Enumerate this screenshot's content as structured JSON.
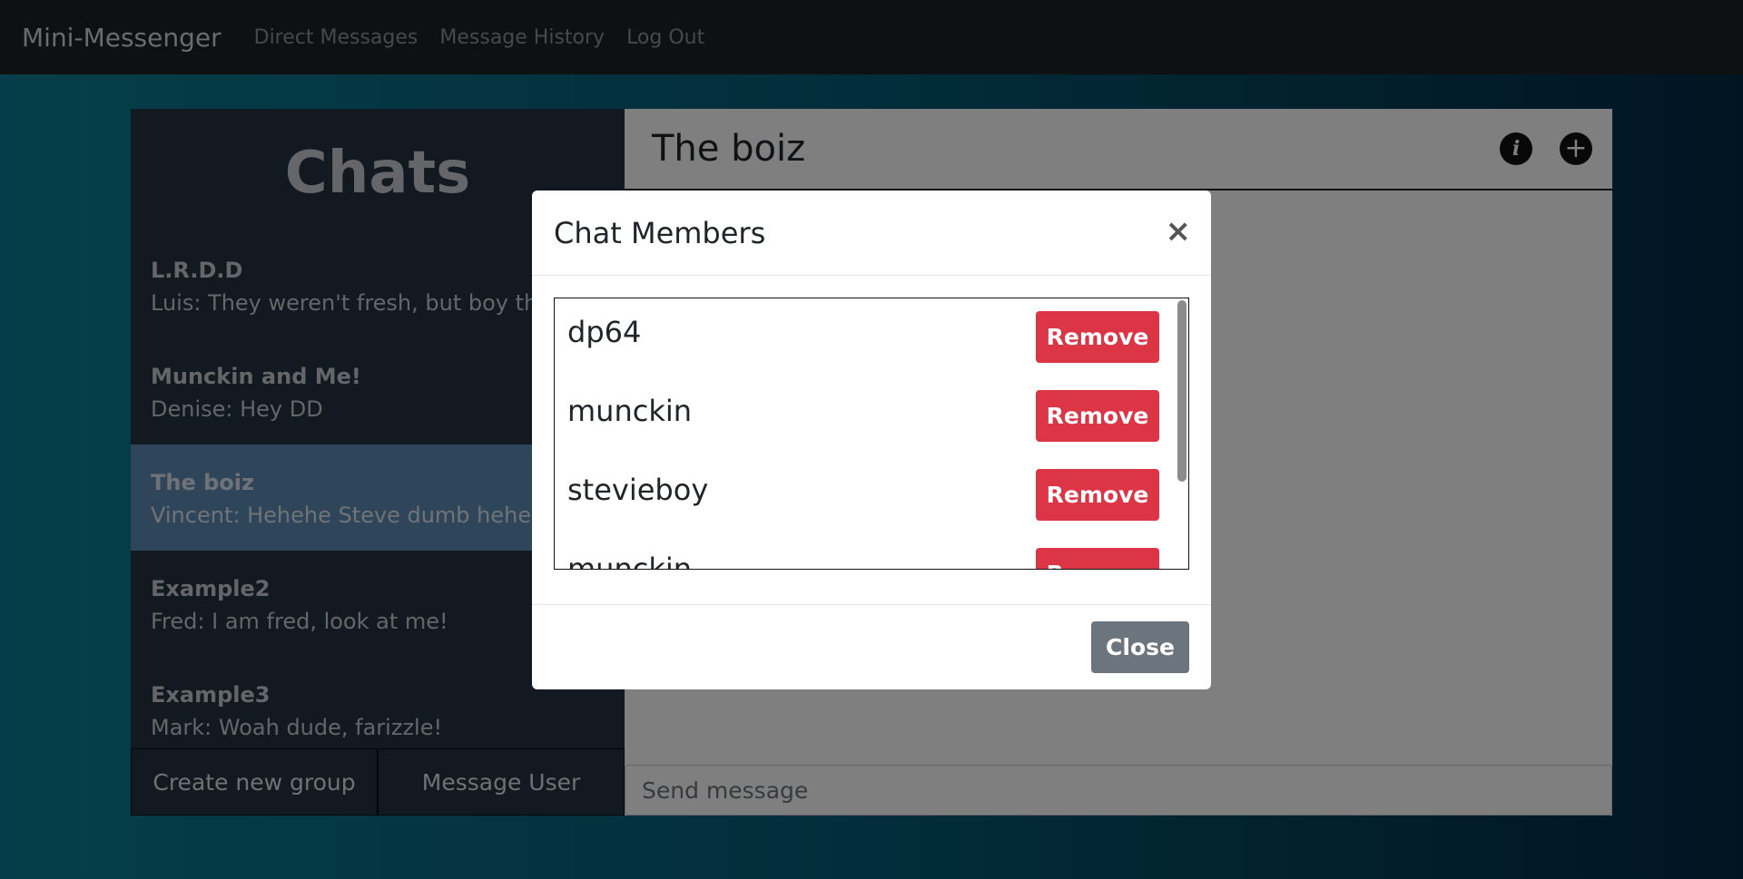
{
  "navbar": {
    "brand": "Mini-Messenger",
    "links": [
      "Direct Messages",
      "Message History",
      "Log Out"
    ]
  },
  "sidebar": {
    "title": "Chats",
    "chats": [
      {
        "name": "L.R.D.D",
        "preview": "Luis: They weren't fresh, but boy they were good!"
      },
      {
        "name": "Munckin and Me!",
        "preview": "Denise: Hey DD"
      },
      {
        "name": "The boiz",
        "preview": "Vincent: Hehehe Steve dumb hehehe"
      },
      {
        "name": "Example2",
        "preview": "Fred: I am fred, look at me!"
      },
      {
        "name": "Example3",
        "preview": "Mark: Woah dude, farizzle!"
      }
    ],
    "create_group_label": "Create new group",
    "message_user_label": "Message User"
  },
  "chat": {
    "title": "The boiz",
    "input_placeholder": "Send message"
  },
  "modal": {
    "title": "Chat Members",
    "close_symbol": "×",
    "members": [
      {
        "name": "dp64",
        "action": "Remove"
      },
      {
        "name": "munckin",
        "action": "Remove"
      },
      {
        "name": "stevieboy",
        "action": "Remove"
      },
      {
        "name": "munckin",
        "action": "Remove"
      }
    ],
    "close_label": "Close"
  },
  "colors": {
    "danger": "#dc3545",
    "secondary": "#6c757d",
    "active_chat": "#5e8db4"
  }
}
